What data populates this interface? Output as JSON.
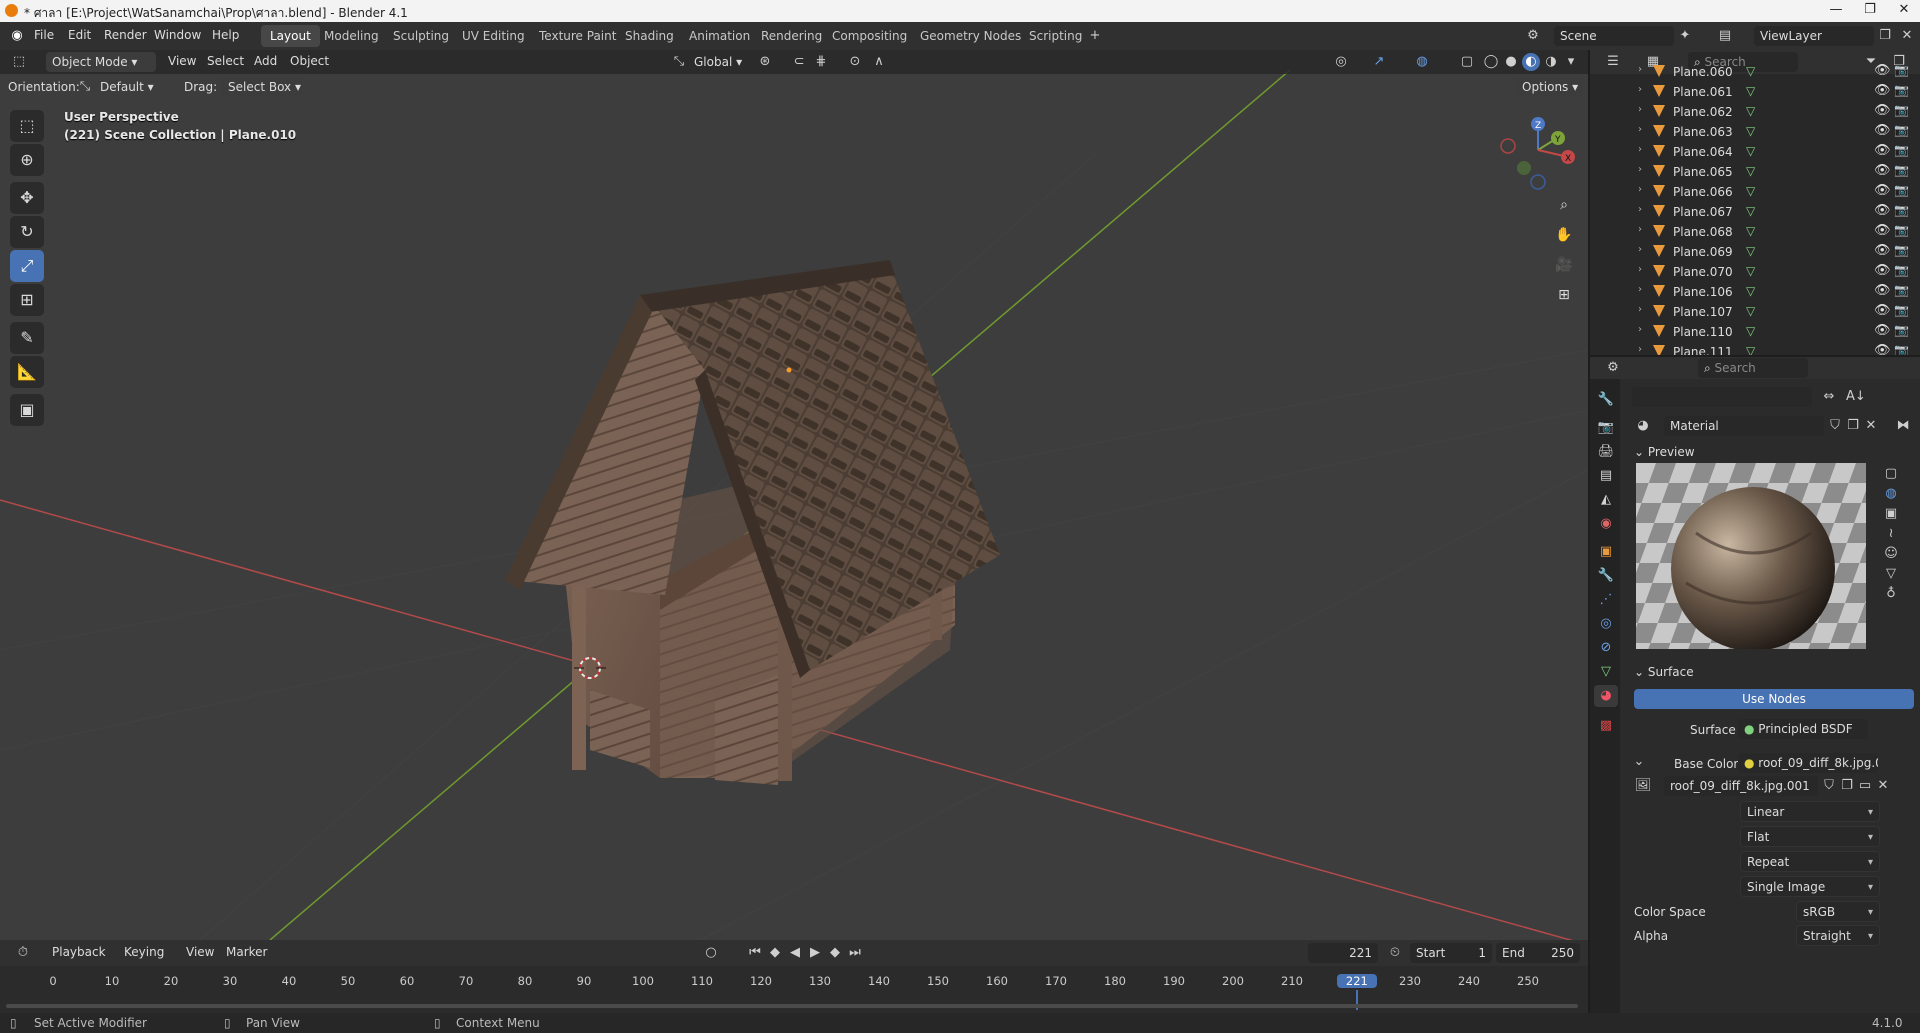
{
  "window": {
    "title": "* ศาลา [E:\\Project\\WatSanamchai\\Prop\\ศาลา.blend] - Blender 4.1",
    "controls": [
      "—",
      "❐",
      "✕"
    ]
  },
  "menu": [
    "File",
    "Edit",
    "Render",
    "Window",
    "Help"
  ],
  "workspaces": [
    "Layout",
    "Modeling",
    "Sculpting",
    "UV Editing",
    "Texture Paint",
    "Shading",
    "Animation",
    "Rendering",
    "Compositing",
    "Geometry Nodes",
    "Scripting"
  ],
  "active_workspace": "Layout",
  "scene": {
    "name": "Scene",
    "view_layer": "ViewLayer"
  },
  "viewport_header": {
    "mode": "Object Mode",
    "menus": [
      "View",
      "Select",
      "Add",
      "Object"
    ],
    "transform_orientation": "Global",
    "orientation_label": "Orientation:",
    "orientation_value": "Default",
    "drag_label": "Drag:",
    "drag_value": "Select Box",
    "options_label": "Options"
  },
  "viewport": {
    "perspective_text": "User Perspective",
    "collection_text": "(221) Scene Collection | Plane.010",
    "gizmo_axes": [
      "Z",
      "Y",
      "X"
    ]
  },
  "tools": [
    "select-box",
    "cursor",
    "move",
    "rotate",
    "scale",
    "transform",
    "annotate",
    "measure",
    "add-cube"
  ],
  "active_tool": "scale",
  "outliner": {
    "search_placeholder": "Search",
    "items": [
      "Plane.060",
      "Plane.061",
      "Plane.062",
      "Plane.063",
      "Plane.064",
      "Plane.065",
      "Plane.066",
      "Plane.067",
      "Plane.068",
      "Plane.069",
      "Plane.070",
      "Plane.106",
      "Plane.107",
      "Plane.110",
      "Plane.111"
    ]
  },
  "properties": {
    "search_placeholder": "Search",
    "material_name": "Material",
    "preview_label": "Preview",
    "surface_label": "Surface",
    "use_nodes_label": "Use Nodes",
    "surface_field_label": "Surface",
    "surface_shader": "Principled BSDF",
    "base_color_label": "Base Color",
    "base_color_value": "roof_09_diff_8k.jpg.0...",
    "image_name": "roof_09_diff_8k.jpg.001",
    "interpolation": "Linear",
    "projection": "Flat",
    "extension": "Repeat",
    "source": "Single Image",
    "color_space_label": "Color Space",
    "color_space_value": "sRGB",
    "alpha_label": "Alpha",
    "alpha_value": "Straight"
  },
  "timeline": {
    "menus": [
      "Playback",
      "Keying",
      "View",
      "Marker"
    ],
    "current_frame": "221",
    "start_label": "Start",
    "start_value": "1",
    "end_label": "End",
    "end_value": "250",
    "ticks": [
      "0",
      "10",
      "20",
      "30",
      "40",
      "50",
      "60",
      "70",
      "80",
      "90",
      "100",
      "110",
      "120",
      "130",
      "140",
      "150",
      "160",
      "170",
      "180",
      "190",
      "200",
      "210",
      "221",
      "230",
      "240",
      "250"
    ]
  },
  "statusbar": {
    "left": "Set Active Modifier",
    "middle": "Pan View",
    "right": "Context Menu",
    "version": "4.1.0"
  },
  "colors": {
    "accent": "#4772b3",
    "orange": "#e89a3c",
    "viewport_bg": "#3d3d3d",
    "x_axis": "#c44848",
    "y_axis": "#7ea33a"
  }
}
